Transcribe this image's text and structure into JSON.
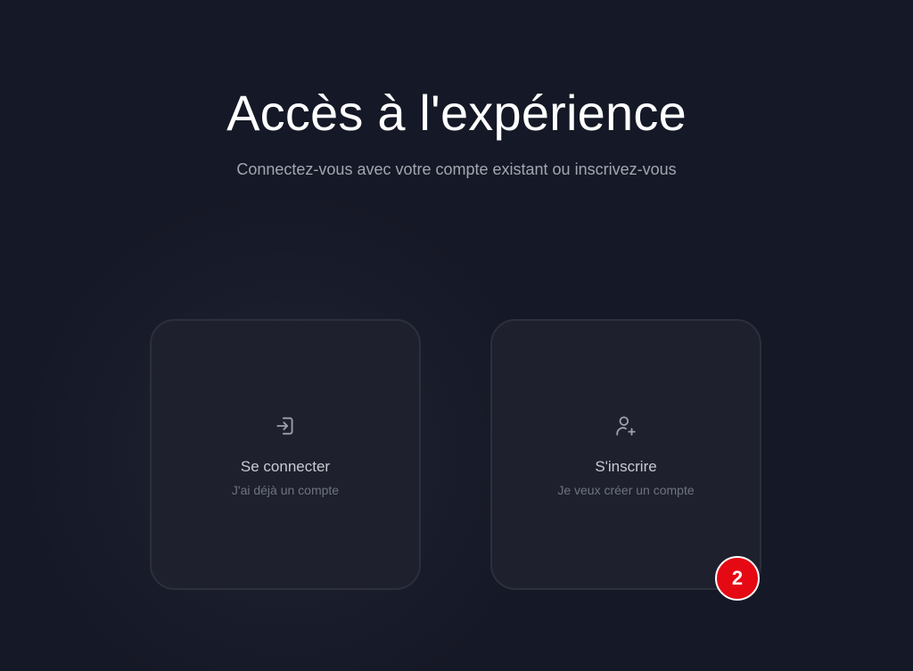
{
  "header": {
    "title": "Accès à l'expérience",
    "subtitle": "Connectez-vous avec votre compte existant ou inscrivez-vous"
  },
  "options": [
    {
      "icon": "sign-in-icon",
      "label": "Se connecter",
      "sublabel": "J'ai déjà un compte"
    },
    {
      "icon": "user-plus-icon",
      "label": "S'inscrire",
      "sublabel": "Je veux créer un compte"
    }
  ],
  "badge": {
    "text": "2",
    "color": "#e50914"
  },
  "colors": {
    "background": "#151826",
    "card": "#1e212d",
    "card_border": "#2c2f3c",
    "icon": "#9ea1ab"
  }
}
